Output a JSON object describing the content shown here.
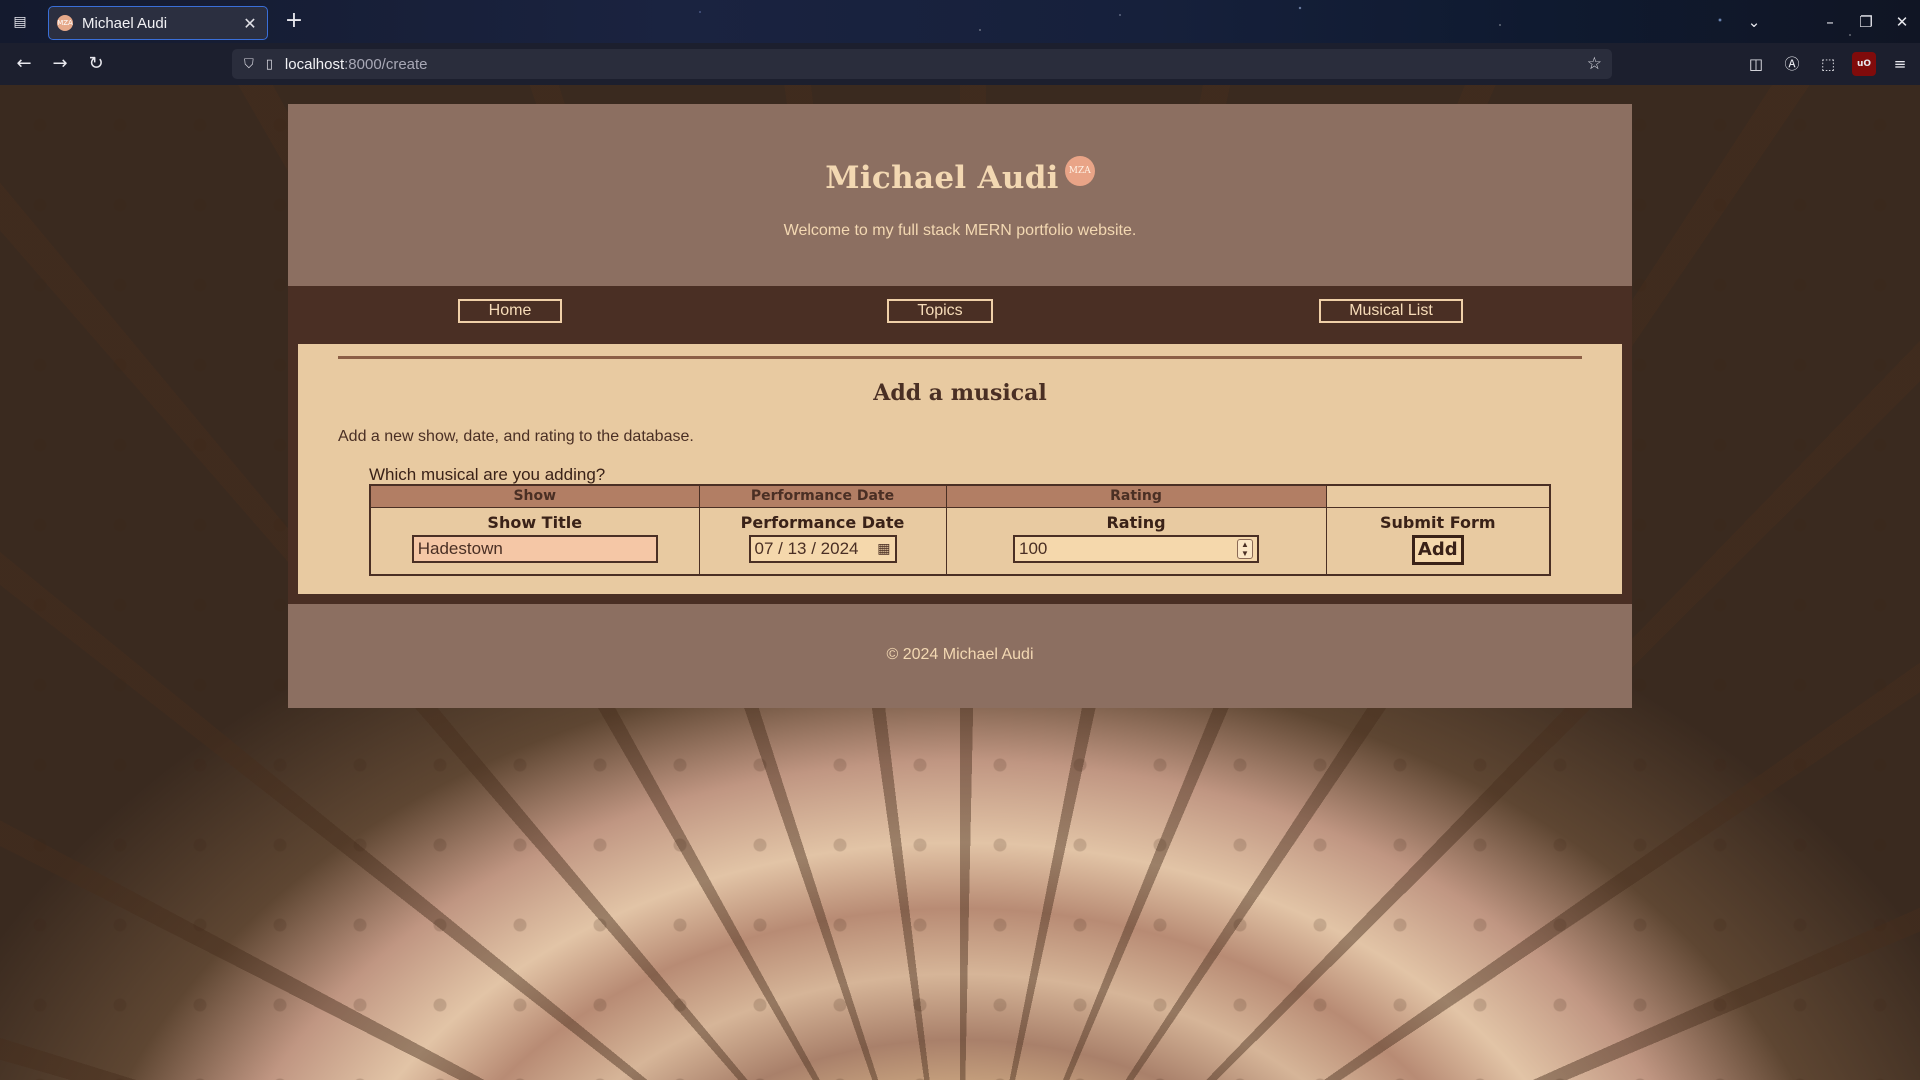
{
  "browser": {
    "tab_title": "Michael Audi",
    "favicon_text": "MZA",
    "url_host": "localhost",
    "url_path": ":8000/create"
  },
  "site": {
    "title": "Michael Audi",
    "logo_text": "MZA",
    "tagline": "Welcome to my full stack MERN portfolio website.",
    "nav": {
      "home": "Home",
      "topics": "Topics",
      "musical_list": "Musical List"
    },
    "page": {
      "heading": "Add a musical",
      "description": "Add a new show, date, and rating to the database.",
      "legend": "Which musical are you adding?",
      "columns": [
        "Show",
        "Performance Date",
        "Rating",
        ""
      ],
      "form": {
        "show_label": "Show Title",
        "show_value": "Hadestown",
        "date_label": "Performance Date",
        "date_value": "07 / 13 / 2024",
        "rating_label": "Rating",
        "rating_value": "100",
        "submit_label": "Submit Form",
        "submit_button": "Add"
      }
    },
    "footer": "© 2024 Michael Audi"
  },
  "colors": {
    "header_bg": "#8c6f61",
    "nav_bg": "#4a2f24",
    "panel_bg": "#f5d8ac",
    "title_color": "#f3d8b2",
    "table_header_bg": "#b27e64",
    "input_bg": "#f5c7a6"
  },
  "icons": {
    "back": "arrow-left-icon",
    "forward": "arrow-right-icon",
    "reload": "reload-icon",
    "bookmark": "star-icon",
    "calendar": "calendar-icon"
  }
}
